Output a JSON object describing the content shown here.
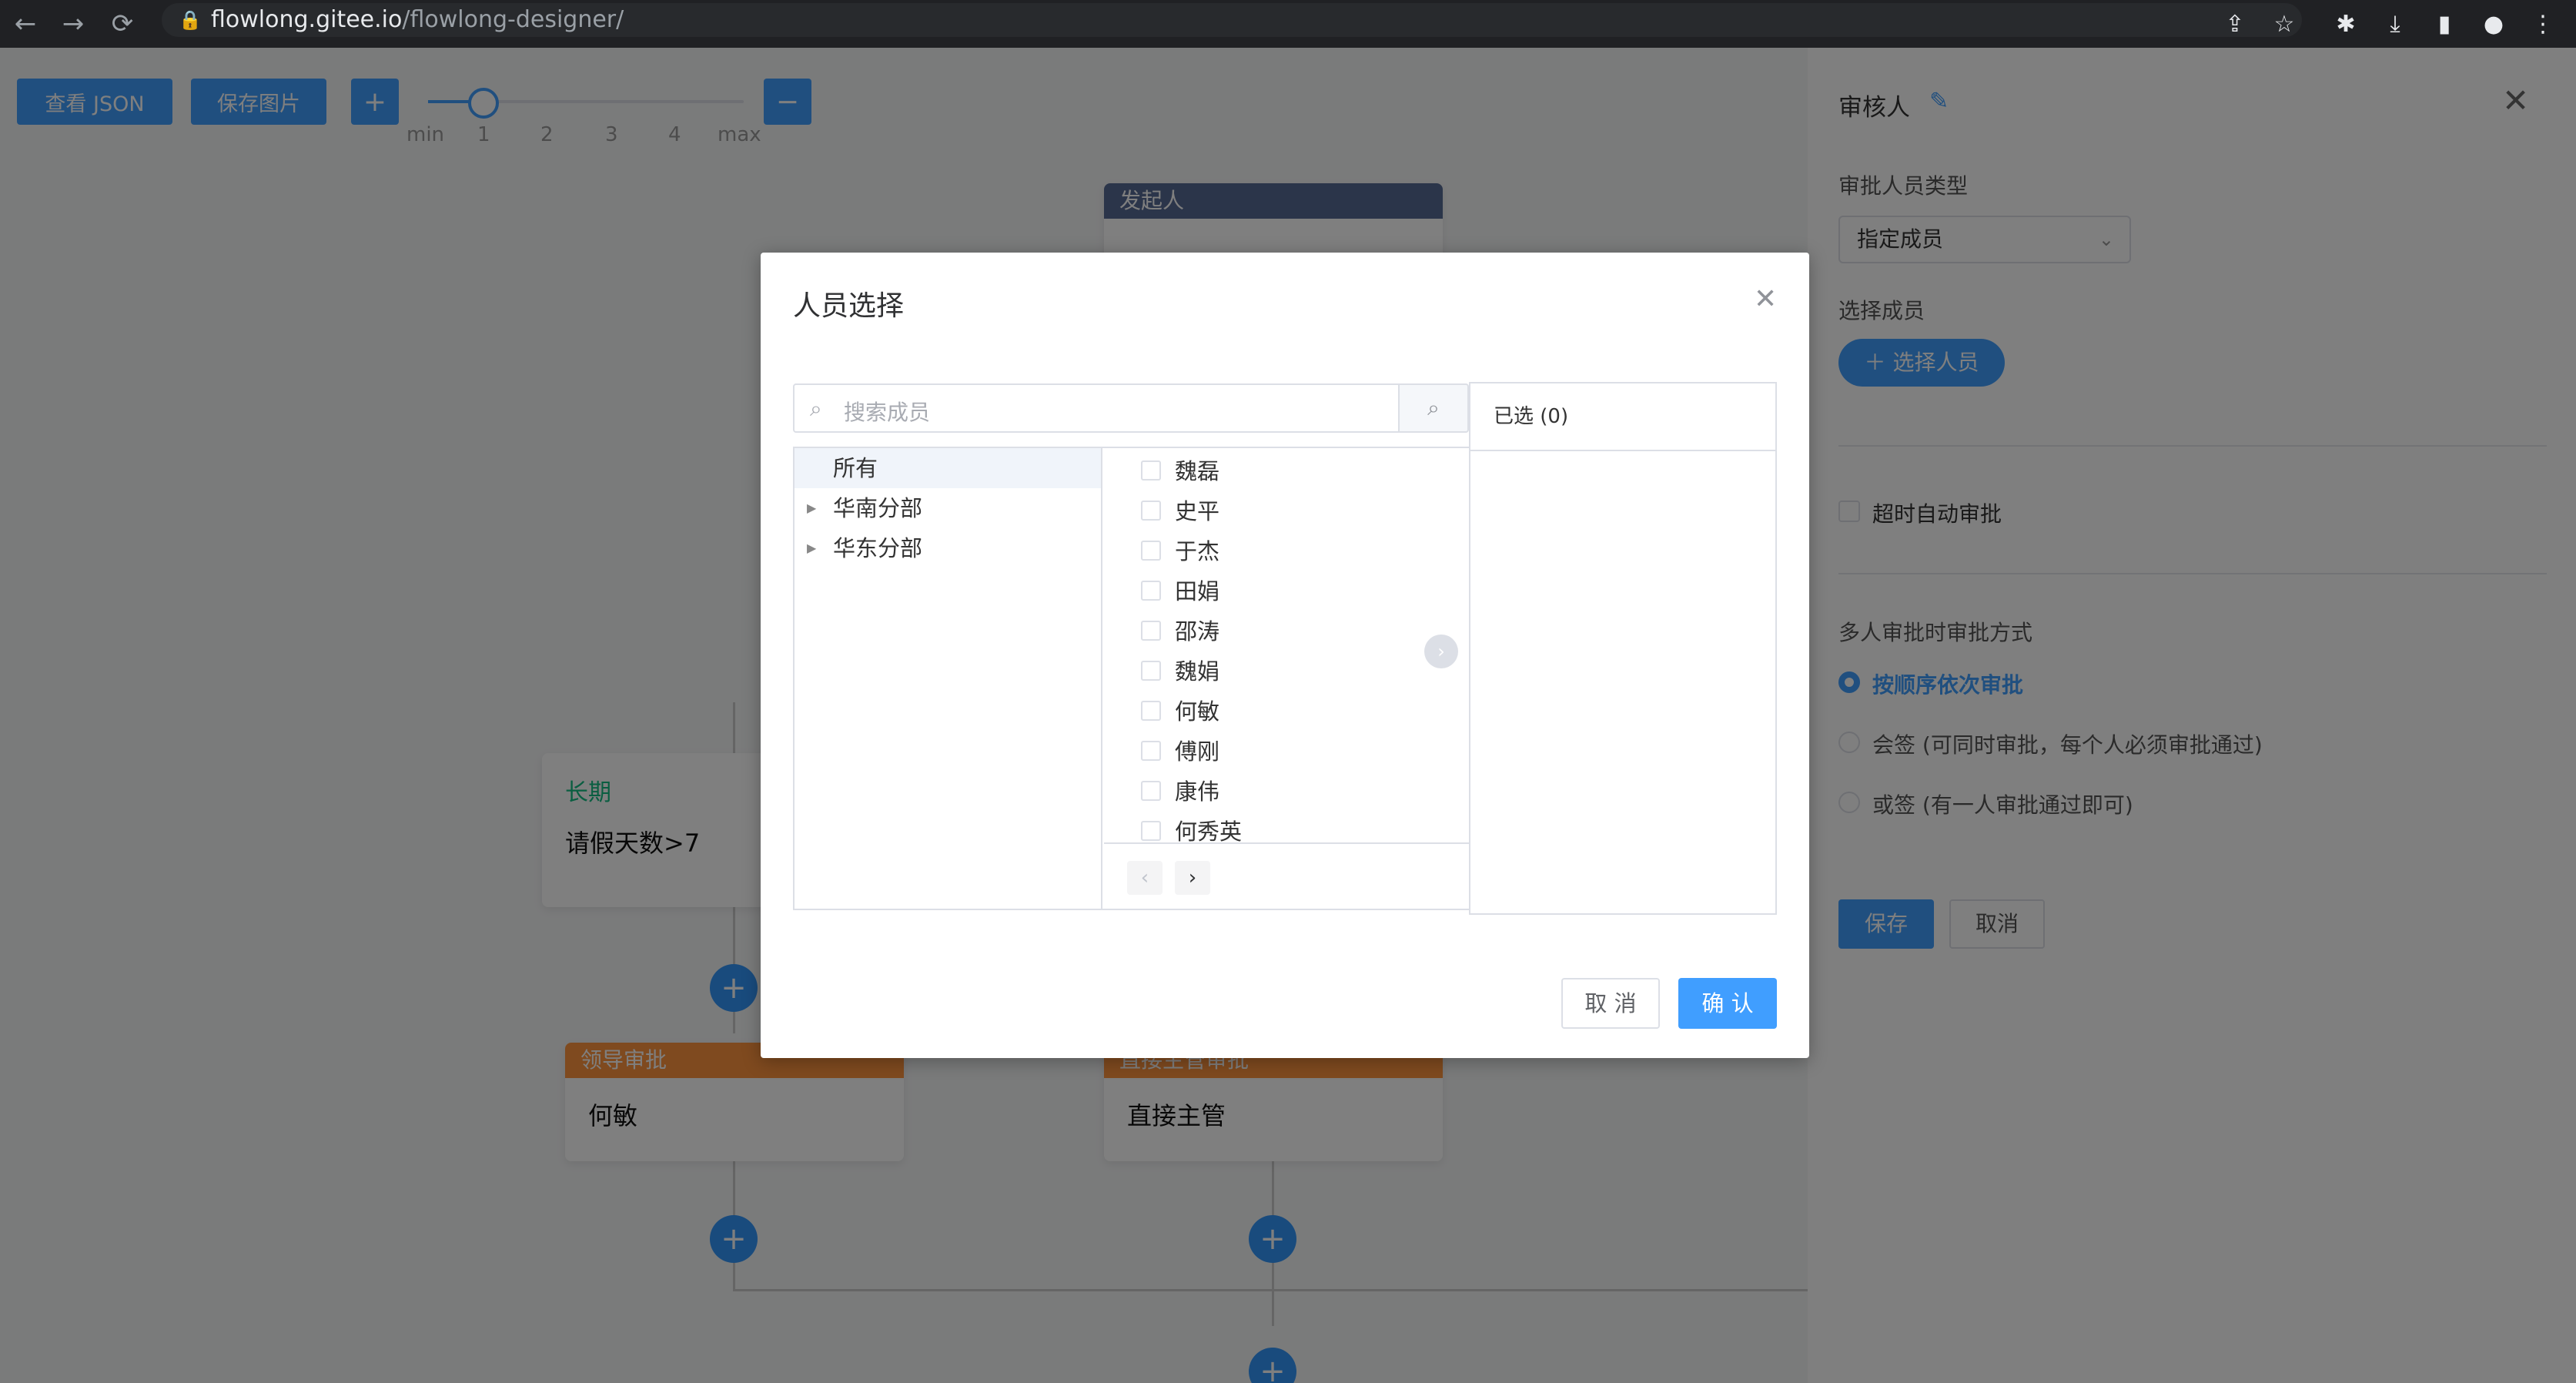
{
  "browser": {
    "url_host": "flowlong.gitee.io",
    "url_path": "/flowlong-designer/",
    "back_icon": "←",
    "forward_icon": "→",
    "reload_icon": "⟳"
  },
  "toolbar": {
    "view_json": "查看 JSON",
    "save_image": "保存图片",
    "zoom_in": "+",
    "zoom_out": "−",
    "zoom_ticks": [
      "min",
      "1",
      "2",
      "3",
      "4",
      "max"
    ],
    "zoom_level": "1"
  },
  "canvas": {
    "start_node_title": "发起人",
    "condition_label": "长期",
    "condition_text": "请假天数>7",
    "leader_node_title": "领导审批",
    "leader_node_value": "何敏",
    "direct_node_title": "直接主管审批",
    "direct_node_value": "直接主管"
  },
  "drawer": {
    "title": "审核人",
    "approver_type_label": "审批人员类型",
    "approver_type_value": "指定成员",
    "select_members_label": "选择成员",
    "select_people_button": "选择人员",
    "auto_approve_label": "超时自动审批",
    "multi_mode_label": "多人审批时审批方式",
    "modes": [
      {
        "label": "按顺序依次审批",
        "selected": true
      },
      {
        "label": "会签 (可同时审批，每个人必须审批通过)",
        "selected": false
      },
      {
        "label": "或签 (有一人审批通过即可)",
        "selected": false
      }
    ],
    "save": "保存",
    "cancel": "取消"
  },
  "dialog": {
    "title": "人员选择",
    "search_placeholder": "搜索成员",
    "tree": [
      {
        "label": "所有",
        "active": true,
        "has_children": false
      },
      {
        "label": "华南分部",
        "active": false,
        "has_children": true
      },
      {
        "label": "华东分部",
        "active": false,
        "has_children": true
      }
    ],
    "members": [
      "魏磊",
      "史平",
      "于杰",
      "田娟",
      "邵涛",
      "魏娟",
      "何敏",
      "傅刚",
      "康伟",
      "何秀英"
    ],
    "selected_header": "已选 (0)",
    "cancel": "取 消",
    "confirm": "确 认"
  },
  "colors": {
    "primary": "#409eff",
    "start_node": "#576a95",
    "approver_node": "#ff943e",
    "condition_green": "#15bc83"
  }
}
